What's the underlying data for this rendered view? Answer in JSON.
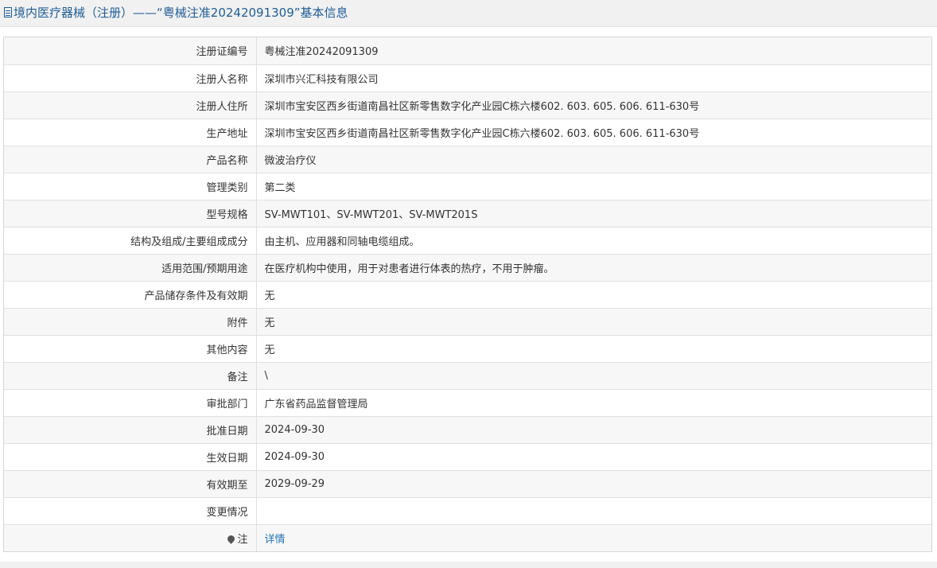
{
  "header": {
    "title": "境内医疗器械（注册）——“粤械注准20242091309”基本信息",
    "icon": "document-icon"
  },
  "rows": [
    {
      "label": "注册证编号",
      "value": "粤械注准20242091309"
    },
    {
      "label": "注册人名称",
      "value": "深圳市兴汇科技有限公司"
    },
    {
      "label": "注册人住所",
      "value": "深圳市宝安区西乡街道南昌社区新零售数字化产业园C栋六楼602. 603. 605. 606. 611-630号"
    },
    {
      "label": "生产地址",
      "value": "深圳市宝安区西乡街道南昌社区新零售数字化产业园C栋六楼602. 603. 605. 606. 611-630号"
    },
    {
      "label": "产品名称",
      "value": "微波治疗仪"
    },
    {
      "label": "管理类别",
      "value": "第二类"
    },
    {
      "label": "型号规格",
      "value": "SV-MWT101、SV-MWT201、SV-MWT201S"
    },
    {
      "label": "结构及组成/主要组成成分",
      "value": "由主机、应用器和同轴电缆组成。"
    },
    {
      "label": "适用范围/预期用途",
      "value": "在医疗机构中使用，用于对患者进行体表的热疗，不用于肿瘤。"
    },
    {
      "label": "产品储存条件及有效期",
      "value": "无"
    },
    {
      "label": "附件",
      "value": "无"
    },
    {
      "label": "其他内容",
      "value": "无"
    },
    {
      "label": "备注",
      "value": "\\"
    },
    {
      "label": "审批部门",
      "value": "广东省药品监督管理局"
    },
    {
      "label": "批准日期",
      "value": "2024-09-30"
    },
    {
      "label": "生效日期",
      "value": "2024-09-30"
    },
    {
      "label": "有效期至",
      "value": "2029-09-29"
    },
    {
      "label": "变更情况",
      "value": ""
    }
  ],
  "note_row": {
    "label": "注",
    "icon": "map-pin-icon",
    "link_text": "详情"
  },
  "colors": {
    "title": "#1f5d97",
    "link": "#1f73b7",
    "row_alt": "#f7f7f7",
    "border": "#e0e0e0"
  }
}
